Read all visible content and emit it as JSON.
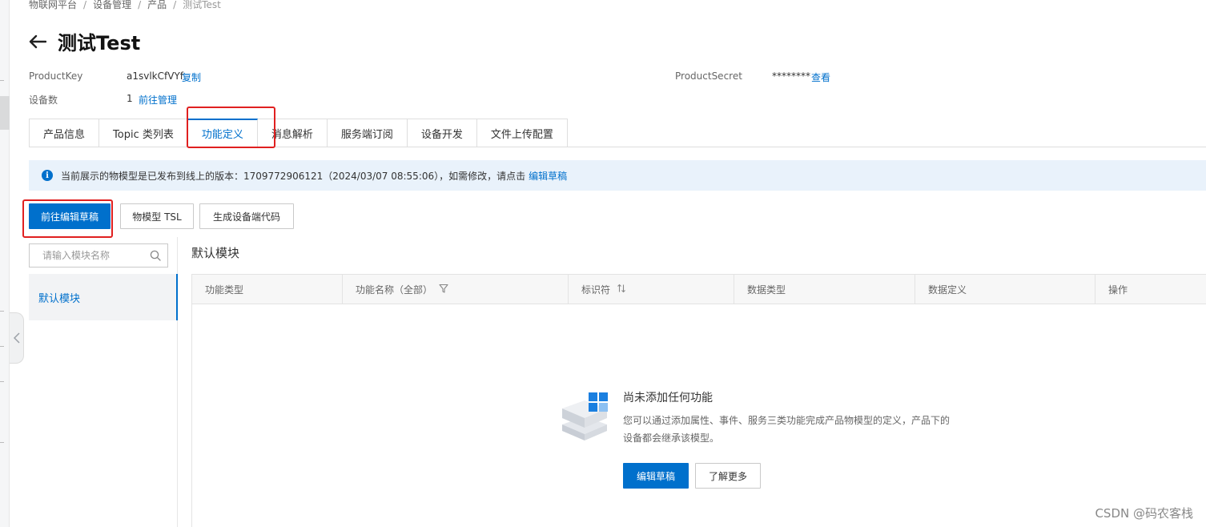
{
  "breadcrumb": [
    "物联网平台",
    "设备管理",
    "产品",
    "测试Test"
  ],
  "title": "测试Test",
  "meta": {
    "product_key_label": "ProductKey",
    "product_key_value": "a1svlkCfVYf",
    "copy_link": "复制",
    "product_secret_label": "ProductSecret",
    "product_secret_value": "********",
    "view_link": "查看",
    "device_count_label": "设备数",
    "device_count_value": "1",
    "manage_link": "前往管理"
  },
  "tabs": [
    "产品信息",
    "Topic 类列表",
    "功能定义",
    "消息解析",
    "服务端订阅",
    "设备开发",
    "文件上传配置"
  ],
  "active_tab": "功能定义",
  "info": {
    "icon": "info-icon",
    "text": "当前展示的物模型是已发布到线上的版本：1709772906121（2024/03/07 08:55:06），如需修改，请点击",
    "link": "编辑草稿"
  },
  "actions": {
    "edit_draft": "前往编辑草稿",
    "tsl": "物模型 TSL",
    "gen_code": "生成设备端代码"
  },
  "module_search": {
    "placeholder": "请输入模块名称",
    "icon": "search-icon"
  },
  "modules": [
    "默认模块"
  ],
  "section_title": "默认模块",
  "table": {
    "columns": [
      "功能类型",
      "功能名称（全部）",
      "标识符",
      "数据类型",
      "数据定义",
      "操作"
    ]
  },
  "empty": {
    "title": "尚未添加任何功能",
    "desc": "您可以通过添加属性、事件、服务三类功能完成产品物模型的定义，产品下的设备都会继承该模型。",
    "primary_button": "编辑草稿",
    "secondary_button": "了解更多"
  },
  "watermark": "CSDN @码农客栈",
  "colors": {
    "primary": "#0070cc",
    "annotation": "#e02020",
    "info_bg": "#e9f2fb"
  }
}
